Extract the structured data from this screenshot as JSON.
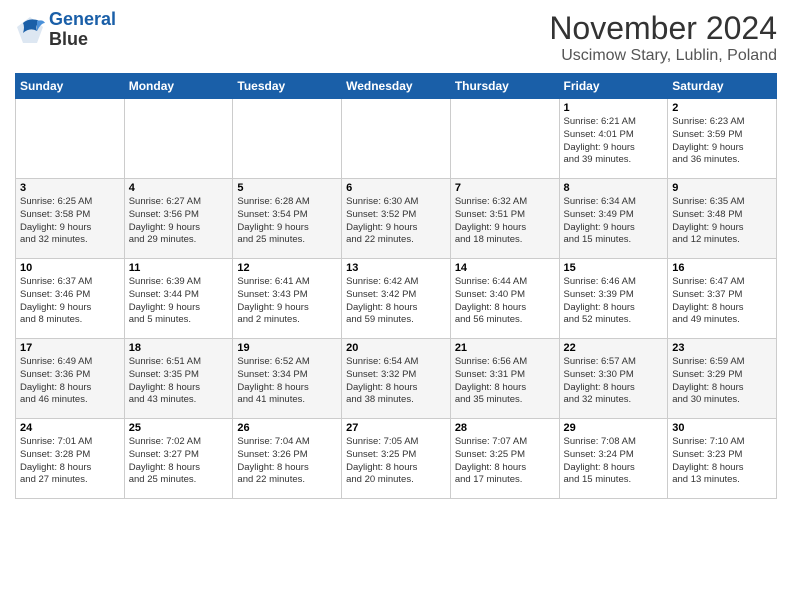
{
  "logo": {
    "line1": "General",
    "line2": "Blue"
  },
  "title": "November 2024",
  "subtitle": "Uscimow Stary, Lublin, Poland",
  "days_of_week": [
    "Sunday",
    "Monday",
    "Tuesday",
    "Wednesday",
    "Thursday",
    "Friday",
    "Saturday"
  ],
  "weeks": [
    [
      {
        "day": "",
        "info": ""
      },
      {
        "day": "",
        "info": ""
      },
      {
        "day": "",
        "info": ""
      },
      {
        "day": "",
        "info": ""
      },
      {
        "day": "",
        "info": ""
      },
      {
        "day": "1",
        "info": "Sunrise: 6:21 AM\nSunset: 4:01 PM\nDaylight: 9 hours\nand 39 minutes."
      },
      {
        "day": "2",
        "info": "Sunrise: 6:23 AM\nSunset: 3:59 PM\nDaylight: 9 hours\nand 36 minutes."
      }
    ],
    [
      {
        "day": "3",
        "info": "Sunrise: 6:25 AM\nSunset: 3:58 PM\nDaylight: 9 hours\nand 32 minutes."
      },
      {
        "day": "4",
        "info": "Sunrise: 6:27 AM\nSunset: 3:56 PM\nDaylight: 9 hours\nand 29 minutes."
      },
      {
        "day": "5",
        "info": "Sunrise: 6:28 AM\nSunset: 3:54 PM\nDaylight: 9 hours\nand 25 minutes."
      },
      {
        "day": "6",
        "info": "Sunrise: 6:30 AM\nSunset: 3:52 PM\nDaylight: 9 hours\nand 22 minutes."
      },
      {
        "day": "7",
        "info": "Sunrise: 6:32 AM\nSunset: 3:51 PM\nDaylight: 9 hours\nand 18 minutes."
      },
      {
        "day": "8",
        "info": "Sunrise: 6:34 AM\nSunset: 3:49 PM\nDaylight: 9 hours\nand 15 minutes."
      },
      {
        "day": "9",
        "info": "Sunrise: 6:35 AM\nSunset: 3:48 PM\nDaylight: 9 hours\nand 12 minutes."
      }
    ],
    [
      {
        "day": "10",
        "info": "Sunrise: 6:37 AM\nSunset: 3:46 PM\nDaylight: 9 hours\nand 8 minutes."
      },
      {
        "day": "11",
        "info": "Sunrise: 6:39 AM\nSunset: 3:44 PM\nDaylight: 9 hours\nand 5 minutes."
      },
      {
        "day": "12",
        "info": "Sunrise: 6:41 AM\nSunset: 3:43 PM\nDaylight: 9 hours\nand 2 minutes."
      },
      {
        "day": "13",
        "info": "Sunrise: 6:42 AM\nSunset: 3:42 PM\nDaylight: 8 hours\nand 59 minutes."
      },
      {
        "day": "14",
        "info": "Sunrise: 6:44 AM\nSunset: 3:40 PM\nDaylight: 8 hours\nand 56 minutes."
      },
      {
        "day": "15",
        "info": "Sunrise: 6:46 AM\nSunset: 3:39 PM\nDaylight: 8 hours\nand 52 minutes."
      },
      {
        "day": "16",
        "info": "Sunrise: 6:47 AM\nSunset: 3:37 PM\nDaylight: 8 hours\nand 49 minutes."
      }
    ],
    [
      {
        "day": "17",
        "info": "Sunrise: 6:49 AM\nSunset: 3:36 PM\nDaylight: 8 hours\nand 46 minutes."
      },
      {
        "day": "18",
        "info": "Sunrise: 6:51 AM\nSunset: 3:35 PM\nDaylight: 8 hours\nand 43 minutes."
      },
      {
        "day": "19",
        "info": "Sunrise: 6:52 AM\nSunset: 3:34 PM\nDaylight: 8 hours\nand 41 minutes."
      },
      {
        "day": "20",
        "info": "Sunrise: 6:54 AM\nSunset: 3:32 PM\nDaylight: 8 hours\nand 38 minutes."
      },
      {
        "day": "21",
        "info": "Sunrise: 6:56 AM\nSunset: 3:31 PM\nDaylight: 8 hours\nand 35 minutes."
      },
      {
        "day": "22",
        "info": "Sunrise: 6:57 AM\nSunset: 3:30 PM\nDaylight: 8 hours\nand 32 minutes."
      },
      {
        "day": "23",
        "info": "Sunrise: 6:59 AM\nSunset: 3:29 PM\nDaylight: 8 hours\nand 30 minutes."
      }
    ],
    [
      {
        "day": "24",
        "info": "Sunrise: 7:01 AM\nSunset: 3:28 PM\nDaylight: 8 hours\nand 27 minutes."
      },
      {
        "day": "25",
        "info": "Sunrise: 7:02 AM\nSunset: 3:27 PM\nDaylight: 8 hours\nand 25 minutes."
      },
      {
        "day": "26",
        "info": "Sunrise: 7:04 AM\nSunset: 3:26 PM\nDaylight: 8 hours\nand 22 minutes."
      },
      {
        "day": "27",
        "info": "Sunrise: 7:05 AM\nSunset: 3:25 PM\nDaylight: 8 hours\nand 20 minutes."
      },
      {
        "day": "28",
        "info": "Sunrise: 7:07 AM\nSunset: 3:25 PM\nDaylight: 8 hours\nand 17 minutes."
      },
      {
        "day": "29",
        "info": "Sunrise: 7:08 AM\nSunset: 3:24 PM\nDaylight: 8 hours\nand 15 minutes."
      },
      {
        "day": "30",
        "info": "Sunrise: 7:10 AM\nSunset: 3:23 PM\nDaylight: 8 hours\nand 13 minutes."
      }
    ]
  ]
}
